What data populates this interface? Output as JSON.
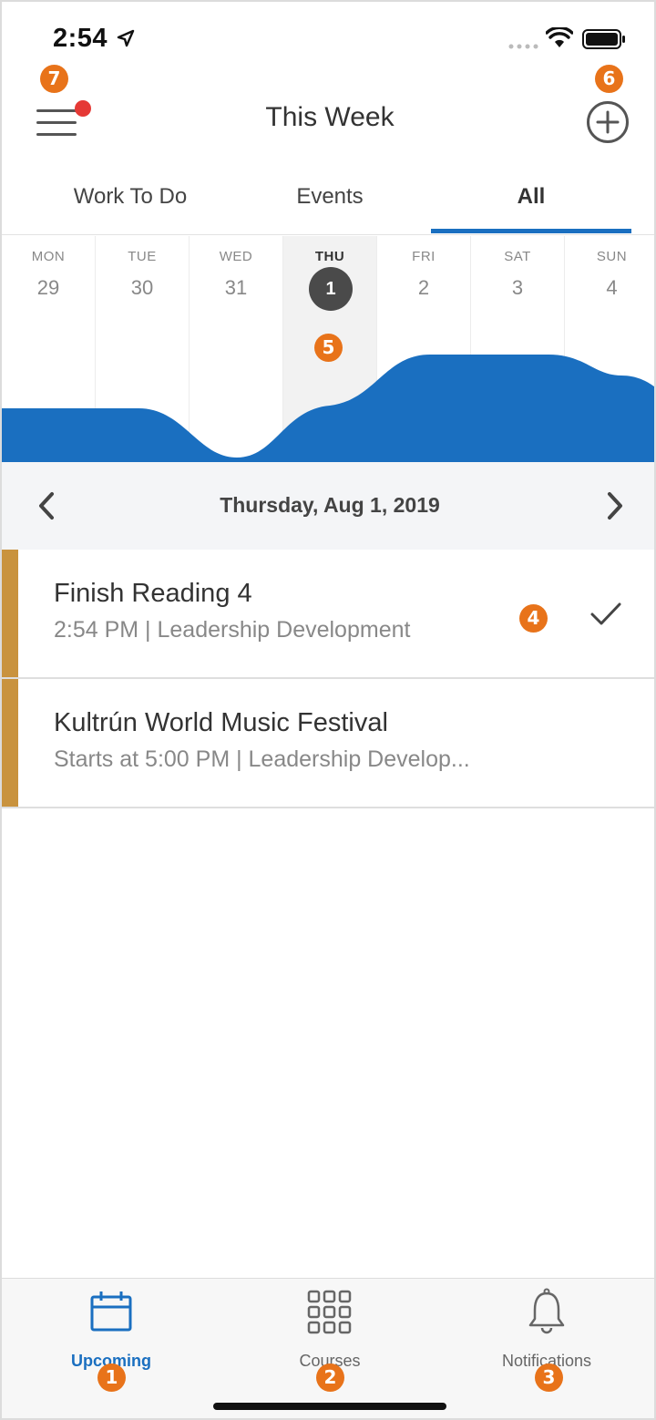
{
  "status_bar": {
    "time": "2:54"
  },
  "header": {
    "title": "This Week",
    "menu_badge": "7",
    "add_badge": "6"
  },
  "tabs": [
    {
      "label": "Work To Do"
    },
    {
      "label": "Events"
    },
    {
      "label": "All",
      "active": true
    }
  ],
  "week": {
    "days": [
      {
        "name": "MON",
        "num": "29"
      },
      {
        "name": "TUE",
        "num": "30"
      },
      {
        "name": "WED",
        "num": "31"
      },
      {
        "name": "THU",
        "num": "1",
        "selected": true
      },
      {
        "name": "FRI",
        "num": "2"
      },
      {
        "name": "SAT",
        "num": "3"
      },
      {
        "name": "SUN",
        "num": "4"
      }
    ],
    "badge": "5"
  },
  "date_nav": {
    "label": "Thursday, Aug 1, 2019"
  },
  "items": [
    {
      "title": "Finish Reading 4",
      "subtitle": "2:54 PM | Leadership Development",
      "badge": "4"
    },
    {
      "title": "Kultrún World Music Festival",
      "subtitle": "Starts at 5:00 PM | Leadership Develop..."
    }
  ],
  "bottom_nav": [
    {
      "label": "Upcoming",
      "badge": "1",
      "active": true
    },
    {
      "label": "Courses",
      "badge": "2"
    },
    {
      "label": "Notifications",
      "badge": "3"
    }
  ],
  "colors": {
    "accent": "#1a6fc0",
    "badge": "#e8731a",
    "item_bar": "#c9933e",
    "dot": "#e53935"
  }
}
